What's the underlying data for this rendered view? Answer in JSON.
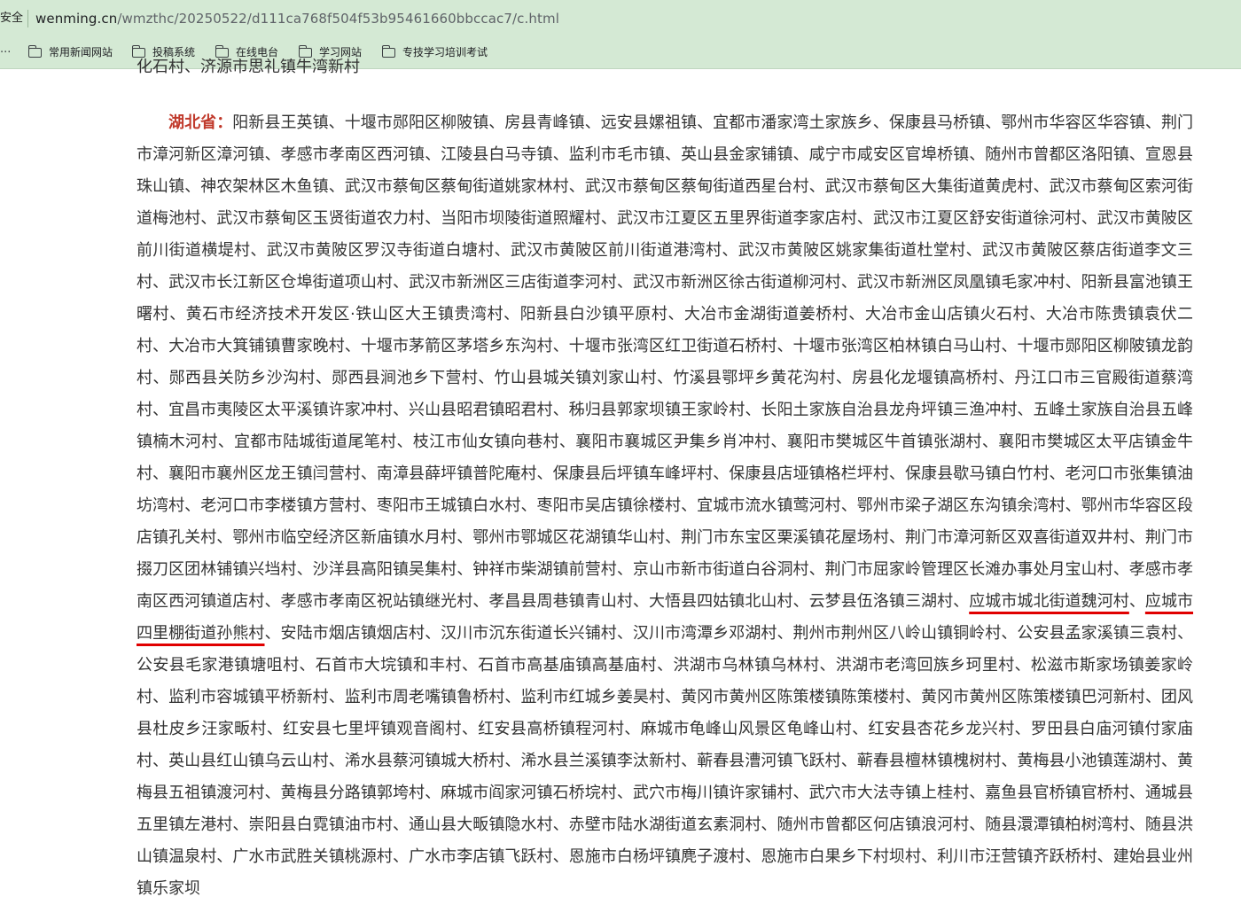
{
  "browser": {
    "security_label": "安全",
    "url_host": "wenming.cn",
    "url_path": "/wmzthc/20250522/d111ca768f504f53b95461660bbccac7/c.html"
  },
  "bookmarks": {
    "overflow": "...",
    "items": [
      {
        "label": "常用新闻网站"
      },
      {
        "label": "投稿系统"
      },
      {
        "label": "在线电台"
      },
      {
        "label": "学习网站"
      },
      {
        "label": "专技学习培训考试"
      }
    ]
  },
  "article": {
    "clipped_line": "化石村、济源市思礼镇牛湾新村",
    "province": "湖北省：",
    "text_before": "阳新县王英镇、十堰市郧阳区柳陂镇、房县青峰镇、远安县嫘祖镇、宜都市潘家湾土家族乡、保康县马桥镇、鄂州市华容区华容镇、荆门市漳河新区漳河镇、孝感市孝南区西河镇、江陵县白马寺镇、监利市毛市镇、英山县金家铺镇、咸宁市咸安区官埠桥镇、随州市曾都区洛阳镇、宣恩县珠山镇、神农架林区木鱼镇、武汉市蔡甸区蔡甸街道姚家林村、武汉市蔡甸区蔡甸街道西星台村、武汉市蔡甸区大集街道黄虎村、武汉市蔡甸区索河街道梅池村、武汉市蔡甸区玉贤街道农力村、当阳市坝陵街道照耀村、武汉市江夏区五里界街道李家店村、武汉市江夏区舒安街道徐河村、武汉市黄陂区前川街道横堤村、武汉市黄陂区罗汉寺街道白塘村、武汉市黄陂区前川街道港湾村、武汉市黄陂区姚家集街道杜堂村、武汉市黄陂区蔡店街道李文三村、武汉市长江新区仓埠街道项山村、武汉市新洲区三店街道李河村、武汉市新洲区徐古街道柳河村、武汉市新洲区凤凰镇毛家冲村、阳新县富池镇王曙村、黄石市经济技术开发区·铁山区大王镇贵湾村、阳新县白沙镇平原村、大冶市金湖街道姜桥村、大冶市金山店镇火石村、大冶市陈贵镇袁伏二村、大冶市大箕铺镇曹家晚村、十堰市茅箭区茅塔乡东沟村、十堰市张湾区红卫街道石桥村、十堰市张湾区柏林镇白马山村、十堰市郧阳区柳陂镇龙韵村、郧西县关防乡沙沟村、郧西县涧池乡下营村、竹山县城关镇刘家山村、竹溪县鄂坪乡黄花沟村、房县化龙堰镇高桥村、丹江口市三官殿街道蔡湾村、宜昌市夷陵区太平溪镇许家冲村、兴山县昭君镇昭君村、秭归县郭家坝镇王家岭村、长阳土家族自治县龙舟坪镇三渔冲村、五峰土家族自治县五峰镇楠木河村、宜都市陆城街道尾笔村、枝江市仙女镇向巷村、襄阳市襄城区尹集乡肖冲村、襄阳市樊城区牛首镇张湖村、襄阳市樊城区太平店镇金牛村、襄阳市襄州区龙王镇闫营村、南漳县薛坪镇普陀庵村、保康县后坪镇车峰坪村、保康县店垭镇格栏坪村、保康县歇马镇白竹村、老河口市张集镇油坊湾村、老河口市李楼镇方营村、枣阳市王城镇白水村、枣阳市吴店镇徐楼村、宜城市流水镇莺河村、鄂州市梁子湖区东沟镇余湾村、鄂州市华容区段店镇孔关村、鄂州市临空经济区新庙镇水月村、鄂州市鄂城区花湖镇华山村、荆门市东宝区栗溪镇花屋场村、荆门市漳河新区双喜街道双井村、荆门市掇刀区团林铺镇兴垱村、沙洋县高阳镇吴集村、钟祥市柴湖镇前营村、京山市新市街道白谷洞村、荆门市屈家岭管理区长滩办事处月宝山村、孝感市孝南区西河镇道店村、孝感市孝南区祝站镇继光村、孝昌县周巷镇青山村、大悟县四姑镇北山村、云梦县伍洛镇三湖村、",
    "highlight_1": "应城市城北街道魏河村",
    "sep": "、",
    "highlight_2": "应城市四里棚街道孙熊村",
    "text_after": "、安陆市烟店镇烟店村、汉川市沉东街道长兴铺村、汉川市湾潭乡邓湖村、荆州市荆州区八岭山镇铜岭村、公安县孟家溪镇三袁村、公安县毛家港镇塘咀村、石首市大垸镇和丰村、石首市高基庙镇高基庙村、洪湖市乌林镇乌林村、洪湖市老湾回族乡珂里村、松滋市斯家场镇姜家岭村、监利市容城镇平桥新村、监利市周老嘴镇鲁桥村、监利市红城乡姜昊村、黄冈市黄州区陈策楼镇陈策楼村、黄冈市黄州区陈策楼镇巴河新村、团风县杜皮乡汪家畈村、红安县七里坪镇观音阁村、红安县高桥镇程河村、麻城市龟峰山风景区龟峰山村、红安县杏花乡龙兴村、罗田县白庙河镇付家庙村、英山县红山镇乌云山村、浠水县蔡河镇城大桥村、浠水县兰溪镇李汰新村、蕲春县漕河镇飞跃村、蕲春县檀林镇槐树村、黄梅县小池镇莲湖村、黄梅县五祖镇渡河村、黄梅县分路镇郭垮村、麻城市阎家河镇石桥垸村、武穴市梅川镇许家铺村、武穴市大法寺镇上桂村、嘉鱼县官桥镇官桥村、通城县五里镇左港村、崇阳县白霓镇油市村、通山县大畈镇隐水村、赤壁市陆水湖街道玄素洞村、随州市曾都区何店镇浪河村、随县澴潭镇柏树湾村、随县洪山镇温泉村、广水市武胜关镇桃源村、广水市李店镇飞跃村、恩施市白杨坪镇麂子渡村、恩施市白果乡下村坝村、利川市汪营镇齐跃桥村、建始县业州镇乐家坝"
  }
}
